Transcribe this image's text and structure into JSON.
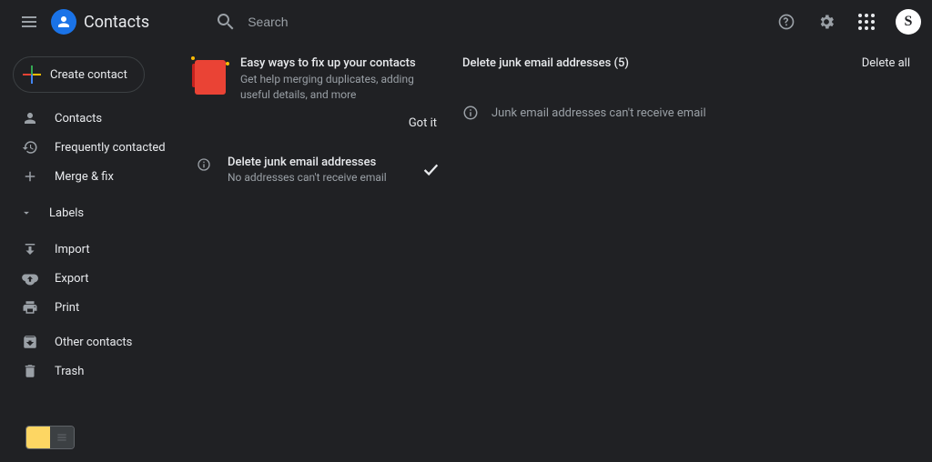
{
  "header": {
    "app_title": "Contacts",
    "search_placeholder": "Search",
    "avatar_letter": "S"
  },
  "sidebar": {
    "create_label": "Create contact",
    "items": [
      {
        "icon": "person",
        "label": "Contacts"
      },
      {
        "icon": "history",
        "label": "Frequently contacted"
      },
      {
        "icon": "merge",
        "label": "Merge & fix"
      }
    ],
    "labels_section": "Labels",
    "items2": [
      {
        "icon": "import",
        "label": "Import"
      },
      {
        "icon": "export",
        "label": "Export"
      },
      {
        "icon": "print",
        "label": "Print"
      }
    ],
    "items3": [
      {
        "icon": "archive",
        "label": "Other contacts"
      },
      {
        "icon": "trash",
        "label": "Trash"
      }
    ]
  },
  "promo": {
    "title": "Easy ways to fix up your contacts",
    "subtitle": "Get help merging duplicates, adding useful details, and more",
    "action": "Got it"
  },
  "fix_card": {
    "title": "Delete junk email addresses",
    "subtitle": "No addresses can't receive email"
  },
  "right_pane": {
    "title": "Delete junk email addresses (5)",
    "delete_all": "Delete all",
    "info": "Junk email addresses can't receive email"
  }
}
